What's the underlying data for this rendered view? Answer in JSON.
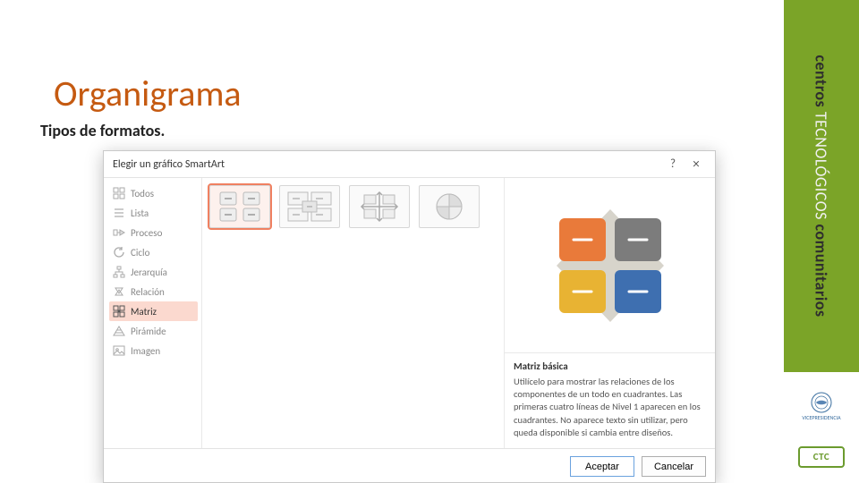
{
  "slide": {
    "title": "Organigrama",
    "subtitle": "Tipos de formatos."
  },
  "dialog": {
    "title": "Elegir un gráfico SmartArt",
    "help": "?",
    "close": "×",
    "categories": [
      {
        "label": "Todos",
        "selected": false
      },
      {
        "label": "Lista",
        "selected": false
      },
      {
        "label": "Proceso",
        "selected": false
      },
      {
        "label": "Ciclo",
        "selected": false
      },
      {
        "label": "Jerarquía",
        "selected": false
      },
      {
        "label": "Relación",
        "selected": false
      },
      {
        "label": "Matriz",
        "selected": true
      },
      {
        "label": "Pirámide",
        "selected": false
      },
      {
        "label": "Imagen",
        "selected": false
      }
    ],
    "preview": {
      "title": "Matriz básica",
      "description": "Utilícelo para mostrar las relaciones de los componentes de un todo en cuadrantes. Las primeras cuatro líneas de Nivel 1 aparecen en los cuadrantes. No aparece texto sin utilizar, pero queda disponible si cambia entre diseños.",
      "colors": {
        "tl": "#E97A3A",
        "tr": "#7C7C7C",
        "bl": "#E8B333",
        "br": "#3E6FB0",
        "diamond": "#D7D4CB"
      }
    },
    "buttons": {
      "accept": "Aceptar",
      "cancel": "Cancelar"
    }
  },
  "sidebar": {
    "label_bold": "centros",
    "label_tech": " TECNOLÓGICOS ",
    "label_com": "comunitarios",
    "logo1_text": "VICEPRESIDENCIA",
    "logo2_text": "CTC"
  }
}
